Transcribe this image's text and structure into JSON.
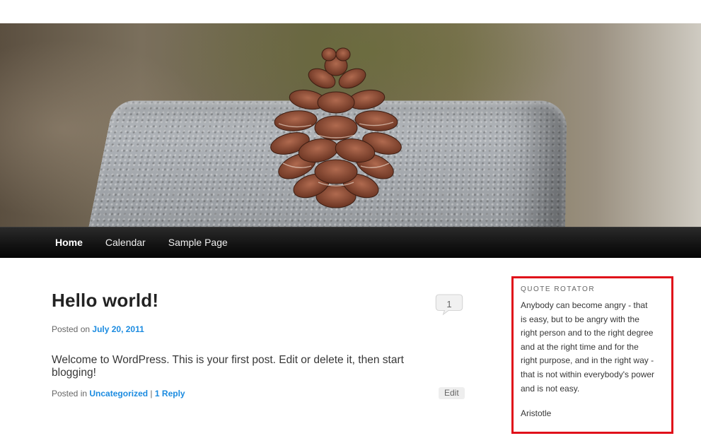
{
  "header": {
    "image_subject": "pinecone-on-granite-photo"
  },
  "nav": {
    "items": [
      "Home",
      "Calendar",
      "Sample Page"
    ]
  },
  "post": {
    "title": "Hello world!",
    "posted_on_label": "Posted on",
    "date": "July 20, 2011",
    "content": "Welcome to WordPress. This is your first post. Edit or delete it, then start blogging!",
    "posted_in_label": "Posted in",
    "category": "Uncategorized",
    "separator": "|",
    "replies": "1 Reply",
    "comment_count": "1",
    "edit_label": "Edit"
  },
  "widget": {
    "title": "QUOTE ROTATOR",
    "quote": "Anybody can become angry - that is easy, but to be angry with the right person and to the right degree and at the right time and for the right purpose, and in the right way - that is not within everybody's power and is not easy.",
    "author": "Aristotle",
    "highlight_color": "#e0101a"
  },
  "colors": {
    "link": "#1b8be0",
    "nav_background": "#141414"
  }
}
